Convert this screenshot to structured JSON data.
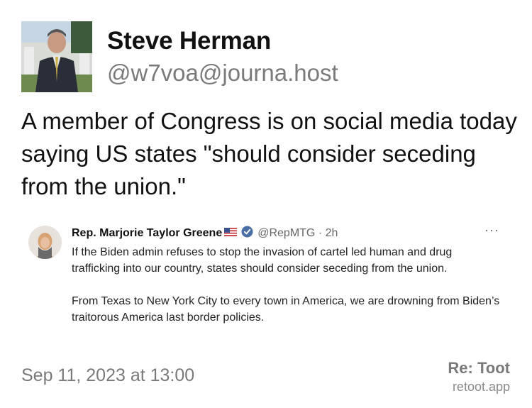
{
  "author": {
    "display_name": "Steve Herman",
    "handle": "@w7voa@journa.host",
    "avatar_icon": "profile-photo"
  },
  "toot": {
    "text": "A member of Congress is on social media today saying US states \"should consider seceding from the union.\""
  },
  "embedded_post": {
    "author_name": "Rep. Marjorie Taylor Greene",
    "flag_icon": "us-flag-icon",
    "verified_icon": "verified-badge-icon",
    "handle_time": "@RepMTG · 2h",
    "more_icon": "···",
    "paragraphs": [
      "If the Biden admin refuses to stop the invasion of cartel led human and drug trafficking into our country, states should consider seceding from the union.",
      "From Texas to New York City to every town in America, we are drowning from Biden’s traitorous America last border policies."
    ]
  },
  "footer": {
    "timestamp": "Sep 11, 2023 at 13:00",
    "brand_title": "Re: Toot",
    "brand_url": "retoot.app"
  },
  "colors": {
    "primary_text": "#111111",
    "secondary_text": "#7a7a7a",
    "verified_blue": "#4a6fa5"
  }
}
